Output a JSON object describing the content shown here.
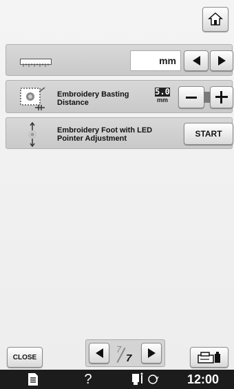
{
  "header": {
    "home_icon": "home-icon"
  },
  "settings": {
    "unit_row": {
      "icon": "ruler-icon",
      "value": "mm",
      "prev_icon": "left-arrow-icon",
      "next_icon": "right-arrow-icon"
    },
    "basting_row": {
      "icon": "basting-frame-icon",
      "label": "Embroidery Basting Distance",
      "value": "5.0",
      "unit": "mm",
      "minus_icon": "minus-icon",
      "plus_icon": "plus-icon"
    },
    "led_row": {
      "icon": "led-pointer-icon",
      "label": "Embroidery Foot with LED Pointer Adjustment",
      "button": "START"
    }
  },
  "footer": {
    "close_label": "CLOSE",
    "page_current": "7",
    "page_total": "7",
    "machine_icon": "machine-settings-icon"
  },
  "status_bar": {
    "doc_icon": "document-icon",
    "help_label": "?",
    "thread_icon": "thread-status-icon",
    "time": "12:00"
  }
}
